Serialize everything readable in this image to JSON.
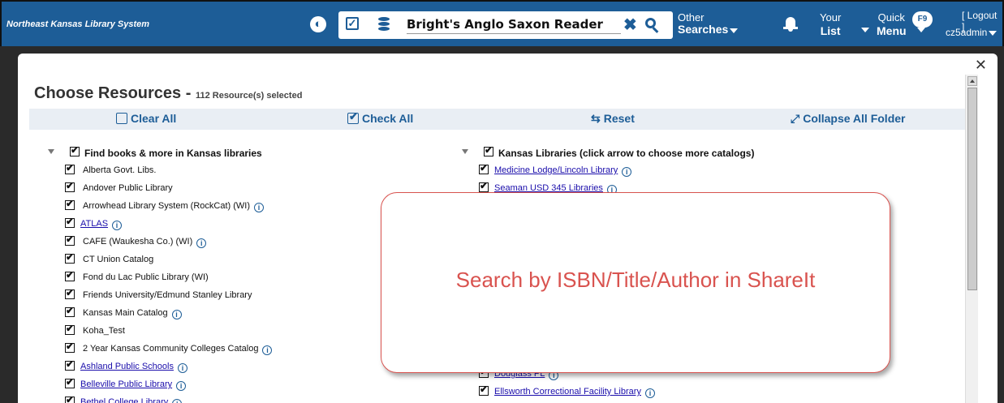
{
  "header": {
    "brand": "Northeast Kansas Library System",
    "search_value": "Bright's Anglo Saxon Reader",
    "other_line1": "Other",
    "other_line2": "Searches",
    "your_line1": "Your",
    "your_line2": "List",
    "quick_line1": "Quick",
    "quick_line2": "Menu",
    "f9_badge": "F9",
    "logout": "[ Logout ]",
    "user": "cz5admin"
  },
  "modal": {
    "title": "Choose Resources -",
    "count": "112 Resource(s) selected",
    "close": "✕"
  },
  "toolbar": {
    "clear_all": "Clear All",
    "check_all": "Check All",
    "reset": "Reset",
    "collapse": "Collapse All Folder"
  },
  "left": {
    "folder": "Find books & more in Kansas libraries",
    "items": [
      {
        "label": "Alberta Govt. Libs.",
        "link": false,
        "info": false
      },
      {
        "label": "Andover Public Library",
        "link": false,
        "info": false
      },
      {
        "label": "Arrowhead Library System (RockCat) (WI)",
        "link": false,
        "info": true
      },
      {
        "label": "ATLAS",
        "link": true,
        "info": true
      },
      {
        "label": "CAFE (Waukesha Co.) (WI)",
        "link": false,
        "info": true
      },
      {
        "label": "CT Union Catalog",
        "link": false,
        "info": false
      },
      {
        "label": "Fond du Lac Public Library (WI)",
        "link": false,
        "info": false
      },
      {
        "label": "Friends University/Edmund Stanley Library",
        "link": false,
        "info": false
      },
      {
        "label": "Kansas Main Catalog",
        "link": false,
        "info": true
      },
      {
        "label": "Koha_Test",
        "link": false,
        "info": false
      },
      {
        "label": "2 Year Kansas Community Colleges Catalog",
        "link": false,
        "info": true
      },
      {
        "label": "Ashland Public Schools",
        "link": true,
        "info": true
      },
      {
        "label": "Belleville Public Library",
        "link": true,
        "info": true
      },
      {
        "label": "Bethel College Library",
        "link": true,
        "info": true
      }
    ]
  },
  "right": {
    "folder": "Kansas Libraries (click arrow to choose more catalogs)",
    "items": [
      {
        "label": "Medicine Lodge/Lincoln Library",
        "link": true,
        "info": true
      },
      {
        "label": "Seaman USD 345 Libraries",
        "link": true,
        "info": true
      }
    ],
    "items_bottom": [
      {
        "label": "Douglass PL",
        "link": true,
        "info": true
      },
      {
        "label": "Ellsworth Correctional Facility Library",
        "link": true,
        "info": true
      }
    ]
  },
  "callout": {
    "text": "Search by ISBN/Title/Author in ShareIt"
  }
}
